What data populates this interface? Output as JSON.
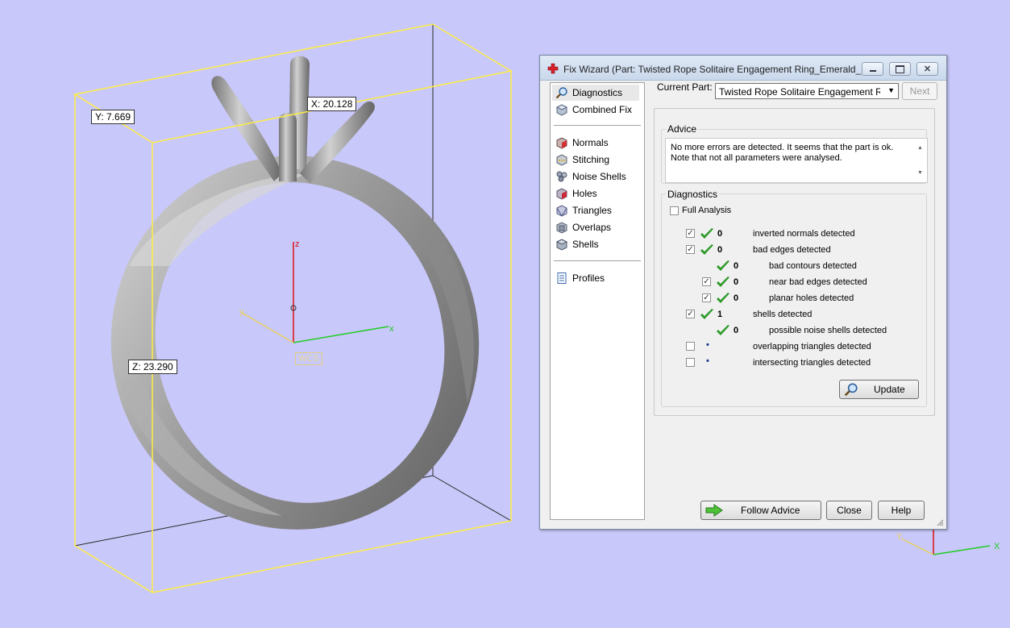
{
  "viewport": {
    "dimensions": {
      "x": "X: 20.128",
      "y": "Y: 7.669",
      "z": "Z: 23.290"
    },
    "wcs_label": "WCS",
    "axes": {
      "x": "x",
      "y": "y",
      "z": "z"
    },
    "corner_axes": {
      "x": "X",
      "y": "Y"
    },
    "colors": {
      "background": "#c8c8fa",
      "bbox": "#ffee44",
      "x_axis": "#22cc22",
      "y_axis": "#e8d060",
      "z_axis": "#dd1111"
    }
  },
  "dialog": {
    "title": "Fix Wizard (Part: Twisted Rope Solitaire Engagement Ring_Emerald_...",
    "nav": {
      "top": [
        {
          "label": "Diagnostics",
          "icon": "magnifier-icon"
        },
        {
          "label": "Combined Fix",
          "icon": "combined-fix-icon"
        }
      ],
      "middle": [
        {
          "label": "Normals",
          "icon": "normals-icon"
        },
        {
          "label": "Stitching",
          "icon": "stitching-icon"
        },
        {
          "label": "Noise Shells",
          "icon": "noise-shells-icon"
        },
        {
          "label": "Holes",
          "icon": "holes-icon"
        },
        {
          "label": "Triangles",
          "icon": "triangles-icon"
        },
        {
          "label": "Overlaps",
          "icon": "overlaps-icon"
        },
        {
          "label": "Shells",
          "icon": "shells-icon"
        }
      ],
      "bottom": [
        {
          "label": "Profiles",
          "icon": "profiles-icon"
        }
      ]
    },
    "current_part_label": "Current Part:",
    "current_part_value": "Twisted Rope Solitaire Engagement Ring_E",
    "next_label": "Next",
    "advice": {
      "title": "Advice",
      "text_line1": "No more errors are detected. It seems that the part is ok.",
      "text_line2": "Note that not all parameters were analysed."
    },
    "diagnostics": {
      "title": "Diagnostics",
      "full_analysis_label": "Full Analysis",
      "rows": [
        {
          "checkbox": true,
          "status": "ok",
          "count": "0",
          "label": "inverted normals detected",
          "indent": 0
        },
        {
          "checkbox": true,
          "status": "ok",
          "count": "0",
          "label": "bad edges detected",
          "indent": 0
        },
        {
          "checkbox": null,
          "status": "ok",
          "count": "0",
          "label": "bad contours detected",
          "indent": 1
        },
        {
          "checkbox": true,
          "status": "ok",
          "count": "0",
          "label": "near bad edges detected",
          "indent": 1
        },
        {
          "checkbox": true,
          "status": "ok",
          "count": "0",
          "label": "planar holes detected",
          "indent": 1
        },
        {
          "checkbox": true,
          "status": "ok",
          "count": "1",
          "label": "shells detected",
          "indent": 0
        },
        {
          "checkbox": null,
          "status": "ok",
          "count": "0",
          "label": "possible noise shells detected",
          "indent": 1
        },
        {
          "checkbox": false,
          "status": "pending",
          "count": "",
          "label": "overlapping triangles detected",
          "indent": 0
        },
        {
          "checkbox": false,
          "status": "pending",
          "count": "",
          "label": "intersecting triangles detected",
          "indent": 0
        }
      ],
      "update_label": "Update"
    },
    "buttons": {
      "follow_advice": "Follow Advice",
      "close": "Close",
      "help": "Help"
    }
  }
}
